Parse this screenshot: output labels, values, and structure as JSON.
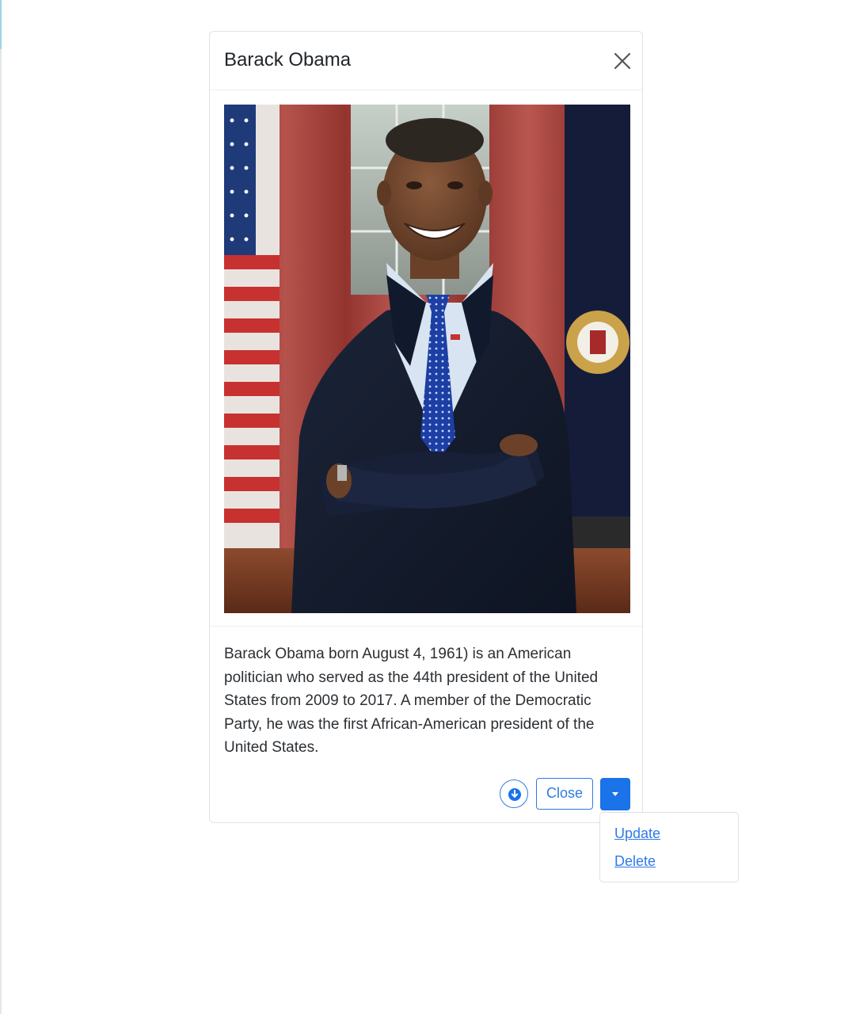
{
  "modal": {
    "title": "Barack Obama",
    "close_icon": "close-icon",
    "photo": {
      "subject": "official presidential portrait",
      "icon": "portrait-image"
    },
    "description": "Barack Obama born August 4, 1961) is an American politician who served as the 44th president of the United States from 2009 to 2017. A member of the Democratic Party, he was the first African-American president of the United States.",
    "footer": {
      "download_icon": "download-icon",
      "close_label": "Close",
      "toggle_icon": "caret-down-icon"
    }
  },
  "dropdown": {
    "items": [
      {
        "label": "Update"
      },
      {
        "label": "Delete"
      }
    ]
  },
  "colors": {
    "accent": "#1a73e8",
    "link": "#2f7ae5",
    "border": "#dfe2e5",
    "text": "#212529"
  }
}
